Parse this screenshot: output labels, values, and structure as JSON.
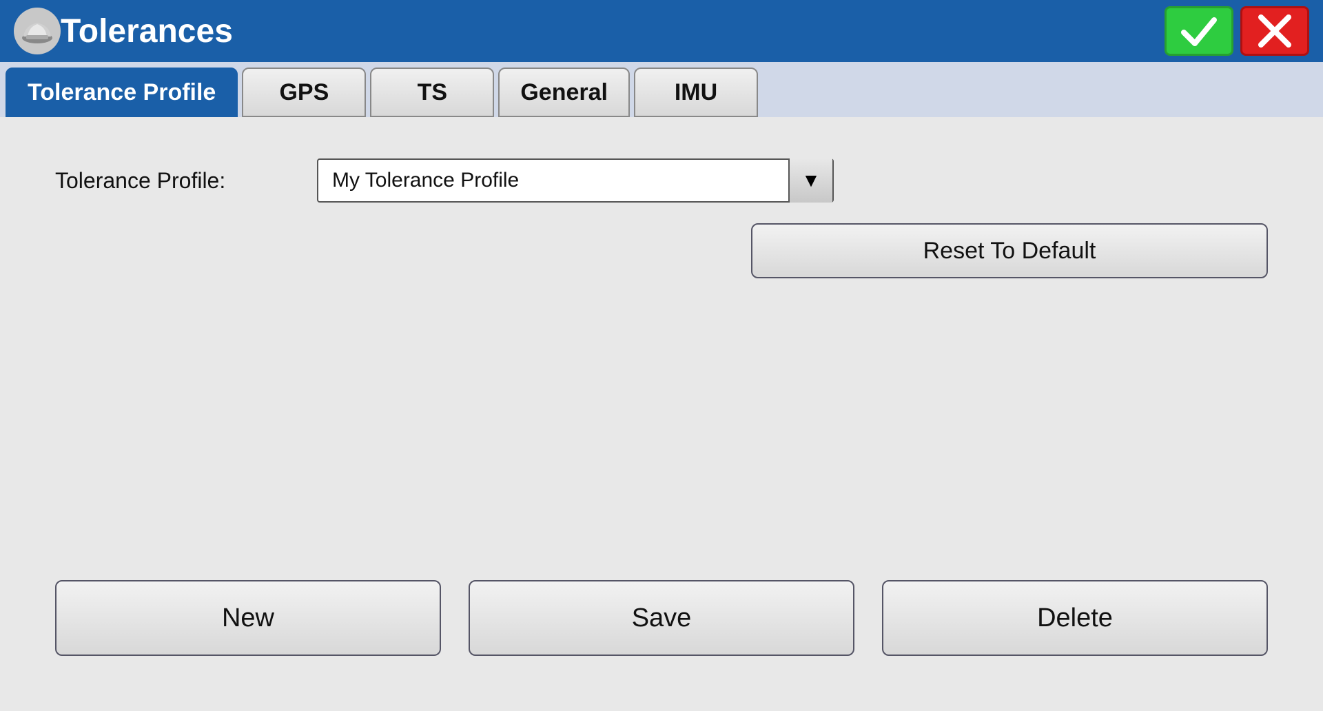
{
  "titleBar": {
    "title": "Tolerances",
    "acceptLabel": "✓",
    "cancelLabel": "✗"
  },
  "tabs": [
    {
      "id": "tolerance-profile",
      "label": "Tolerance Profile",
      "active": true
    },
    {
      "id": "gps",
      "label": "GPS",
      "active": false
    },
    {
      "id": "ts",
      "label": "TS",
      "active": false
    },
    {
      "id": "general",
      "label": "General",
      "active": false
    },
    {
      "id": "imu",
      "label": "IMU",
      "active": false
    }
  ],
  "form": {
    "profileLabel": "Tolerance Profile:",
    "profileValue": "My Tolerance Profile",
    "resetButtonLabel": "Reset To Default"
  },
  "bottomButtons": {
    "newLabel": "New",
    "saveLabel": "Save",
    "deleteLabel": "Delete"
  },
  "dropdown": {
    "arrowChar": "▼"
  }
}
